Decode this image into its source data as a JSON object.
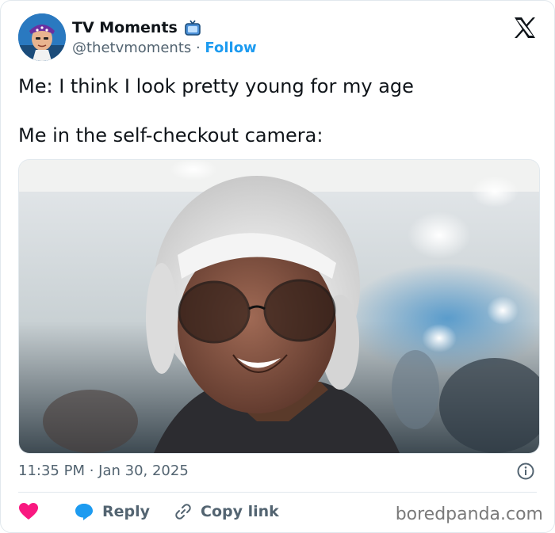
{
  "account": {
    "name": "TV Moments",
    "handle": "@thetvmoments",
    "separator": " · ",
    "follow_label": "Follow"
  },
  "tweet": {
    "line1": "Me: I think I look pretty young for my age",
    "line2": "Me in the self-checkout camera:",
    "timestamp": "11:35 PM · Jan 30, 2025"
  },
  "actions": {
    "reply_label": "Reply",
    "copy_link_label": "Copy link"
  },
  "watermark": "boredpanda.com",
  "icons": {
    "verified": "tv-icon",
    "brand": "x-logo-icon",
    "like": "heart-icon",
    "reply": "speech-bubble-icon",
    "copy": "link-icon",
    "info": "info-icon"
  },
  "colors": {
    "accent": "#1d9bf0",
    "heart": "#f91880",
    "muted": "#536471",
    "text": "#0f1419"
  }
}
